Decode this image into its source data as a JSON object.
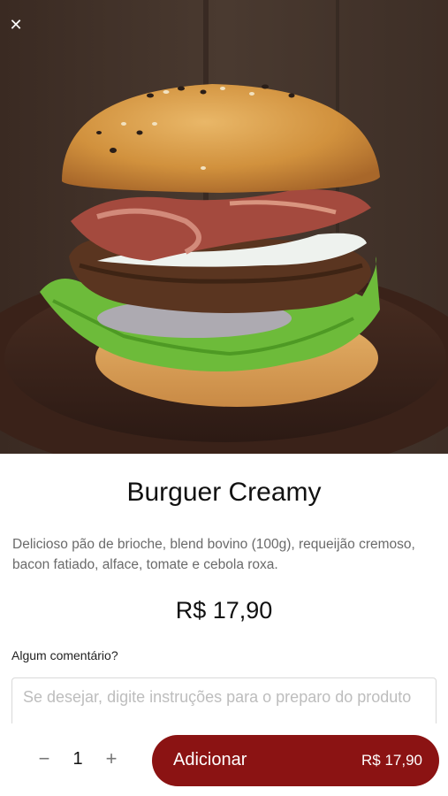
{
  "header": {
    "close_icon": "close-icon",
    "close_glyph": "✕"
  },
  "product": {
    "name": "Burguer Creamy",
    "description": "Delicioso pão de brioche, blend bovino (100g), requeijão cremoso, bacon fatiado, alface, tomate e cebola roxa.",
    "price": "R$ 17,90"
  },
  "comment": {
    "label": "Algum comentário?",
    "placeholder": "Se desejar, digite instruções para o preparo do produto",
    "value": ""
  },
  "footer": {
    "minus_glyph": "−",
    "plus_glyph": "+",
    "quantity": "1",
    "add_label": "Adicionar",
    "add_price": "R$ 17,90"
  },
  "colors": {
    "accent": "#8b1313",
    "description_text": "#6a6a6a"
  }
}
